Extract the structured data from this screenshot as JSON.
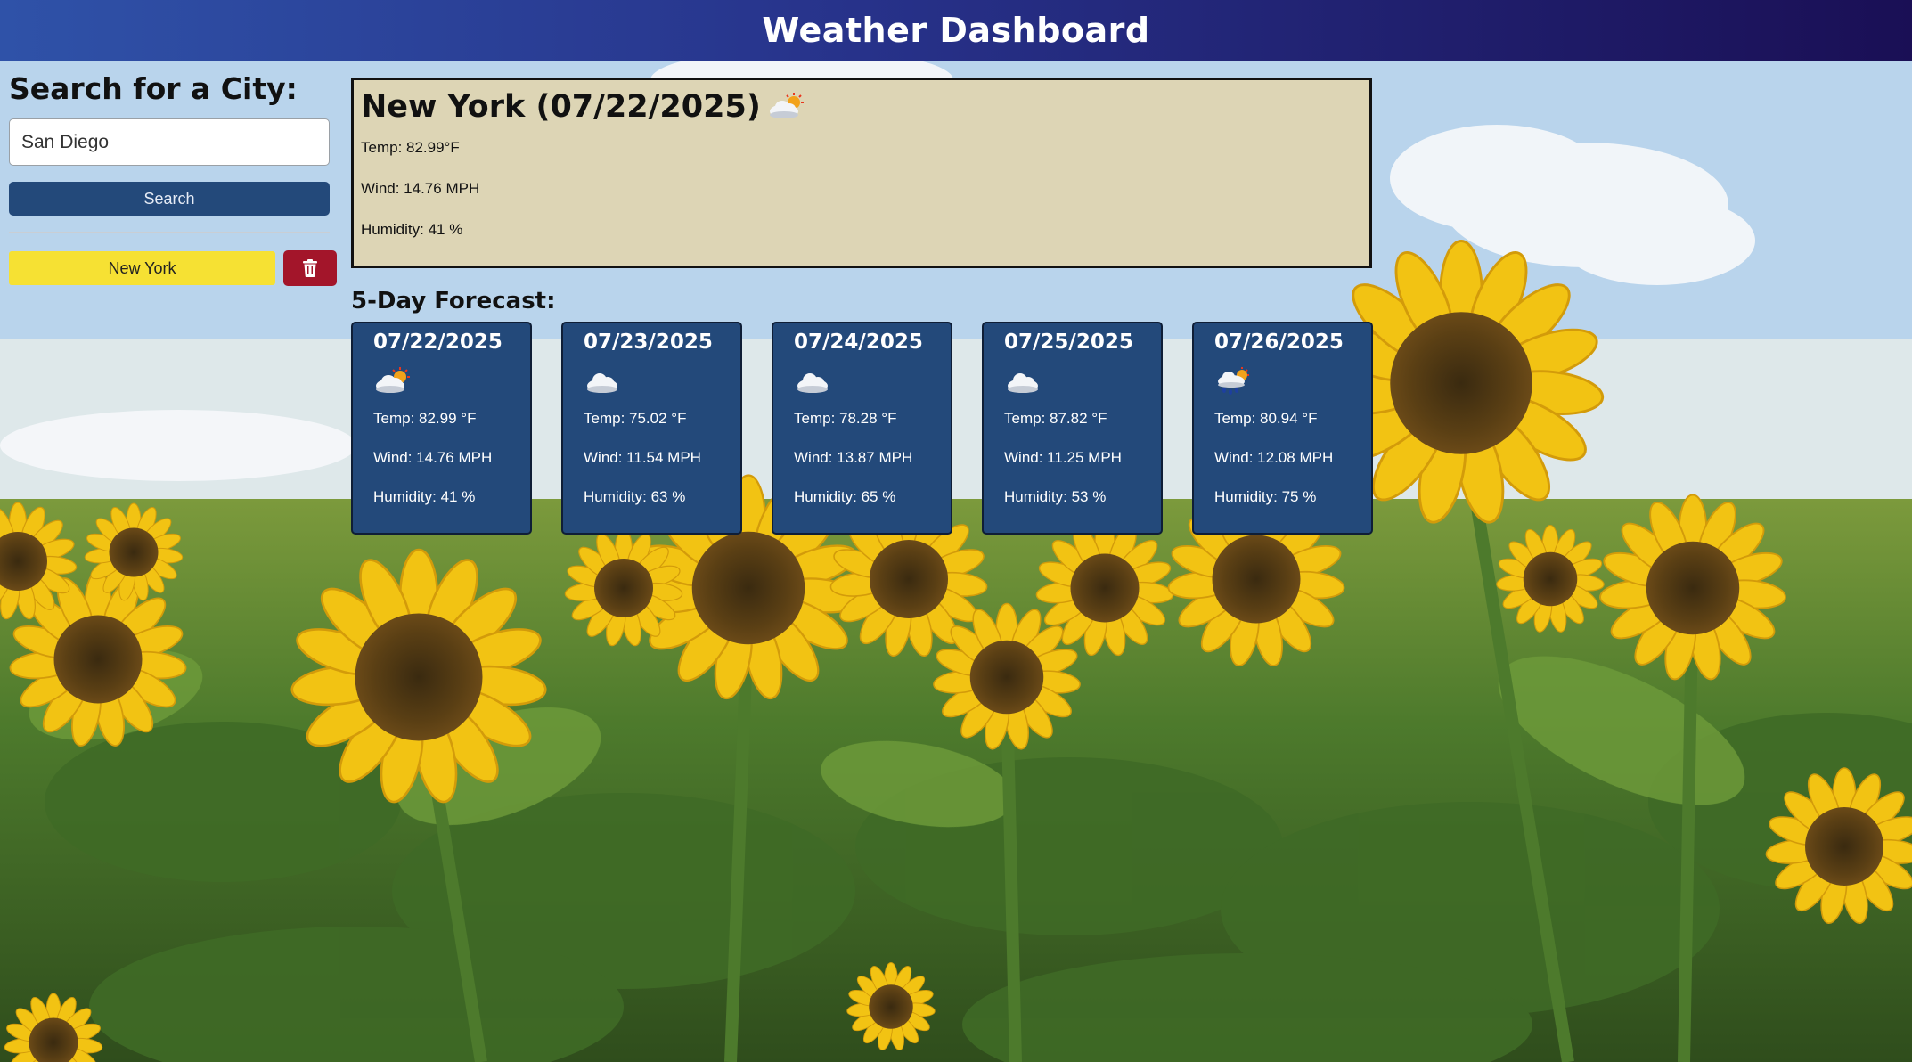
{
  "header": {
    "title": "Weather Dashboard"
  },
  "sidebar": {
    "heading": "Search for a City:",
    "search_value": "San Diego",
    "search_button": "Search",
    "history": [
      {
        "city": "New York"
      }
    ],
    "delete_icon": "trash-icon"
  },
  "current": {
    "title": "New York (07/22/2025)",
    "icon": "partly-cloudy-sun-icon",
    "temp": "Temp: 82.99°F",
    "wind": "Wind: 14.76 MPH",
    "humidity": "Humidity: 41 %"
  },
  "forecast": {
    "heading": "5-Day Forecast:",
    "days": [
      {
        "date": "07/22/2025",
        "icon": "partly-cloudy-sun-icon",
        "temp": "Temp: 82.99 °F",
        "wind": "Wind: 14.76 MPH",
        "humidity": "Humidity: 41 %"
      },
      {
        "date": "07/23/2025",
        "icon": "cloud-icon",
        "temp": "Temp: 75.02 °F",
        "wind": "Wind: 11.54 MPH",
        "humidity": "Humidity: 63 %"
      },
      {
        "date": "07/24/2025",
        "icon": "cloud-icon",
        "temp": "Temp: 78.28 °F",
        "wind": "Wind: 13.87 MPH",
        "humidity": "Humidity: 65 %"
      },
      {
        "date": "07/25/2025",
        "icon": "cloud-icon",
        "temp": "Temp: 87.82 °F",
        "wind": "Wind: 11.25 MPH",
        "humidity": "Humidity: 53 %"
      },
      {
        "date": "07/26/2025",
        "icon": "rain-sun-cloud-icon",
        "temp": "Temp: 80.94 °F",
        "wind": "Wind: 12.08 MPH",
        "humidity": "Humidity: 75 %"
      }
    ]
  },
  "colors": {
    "header_start": "#2f52a8",
    "header_end": "#1a0f55",
    "button_blue": "#23497a",
    "history_yellow": "#f6e133",
    "delete_red": "#a3152a",
    "current_bg": "#ddd5b5"
  }
}
